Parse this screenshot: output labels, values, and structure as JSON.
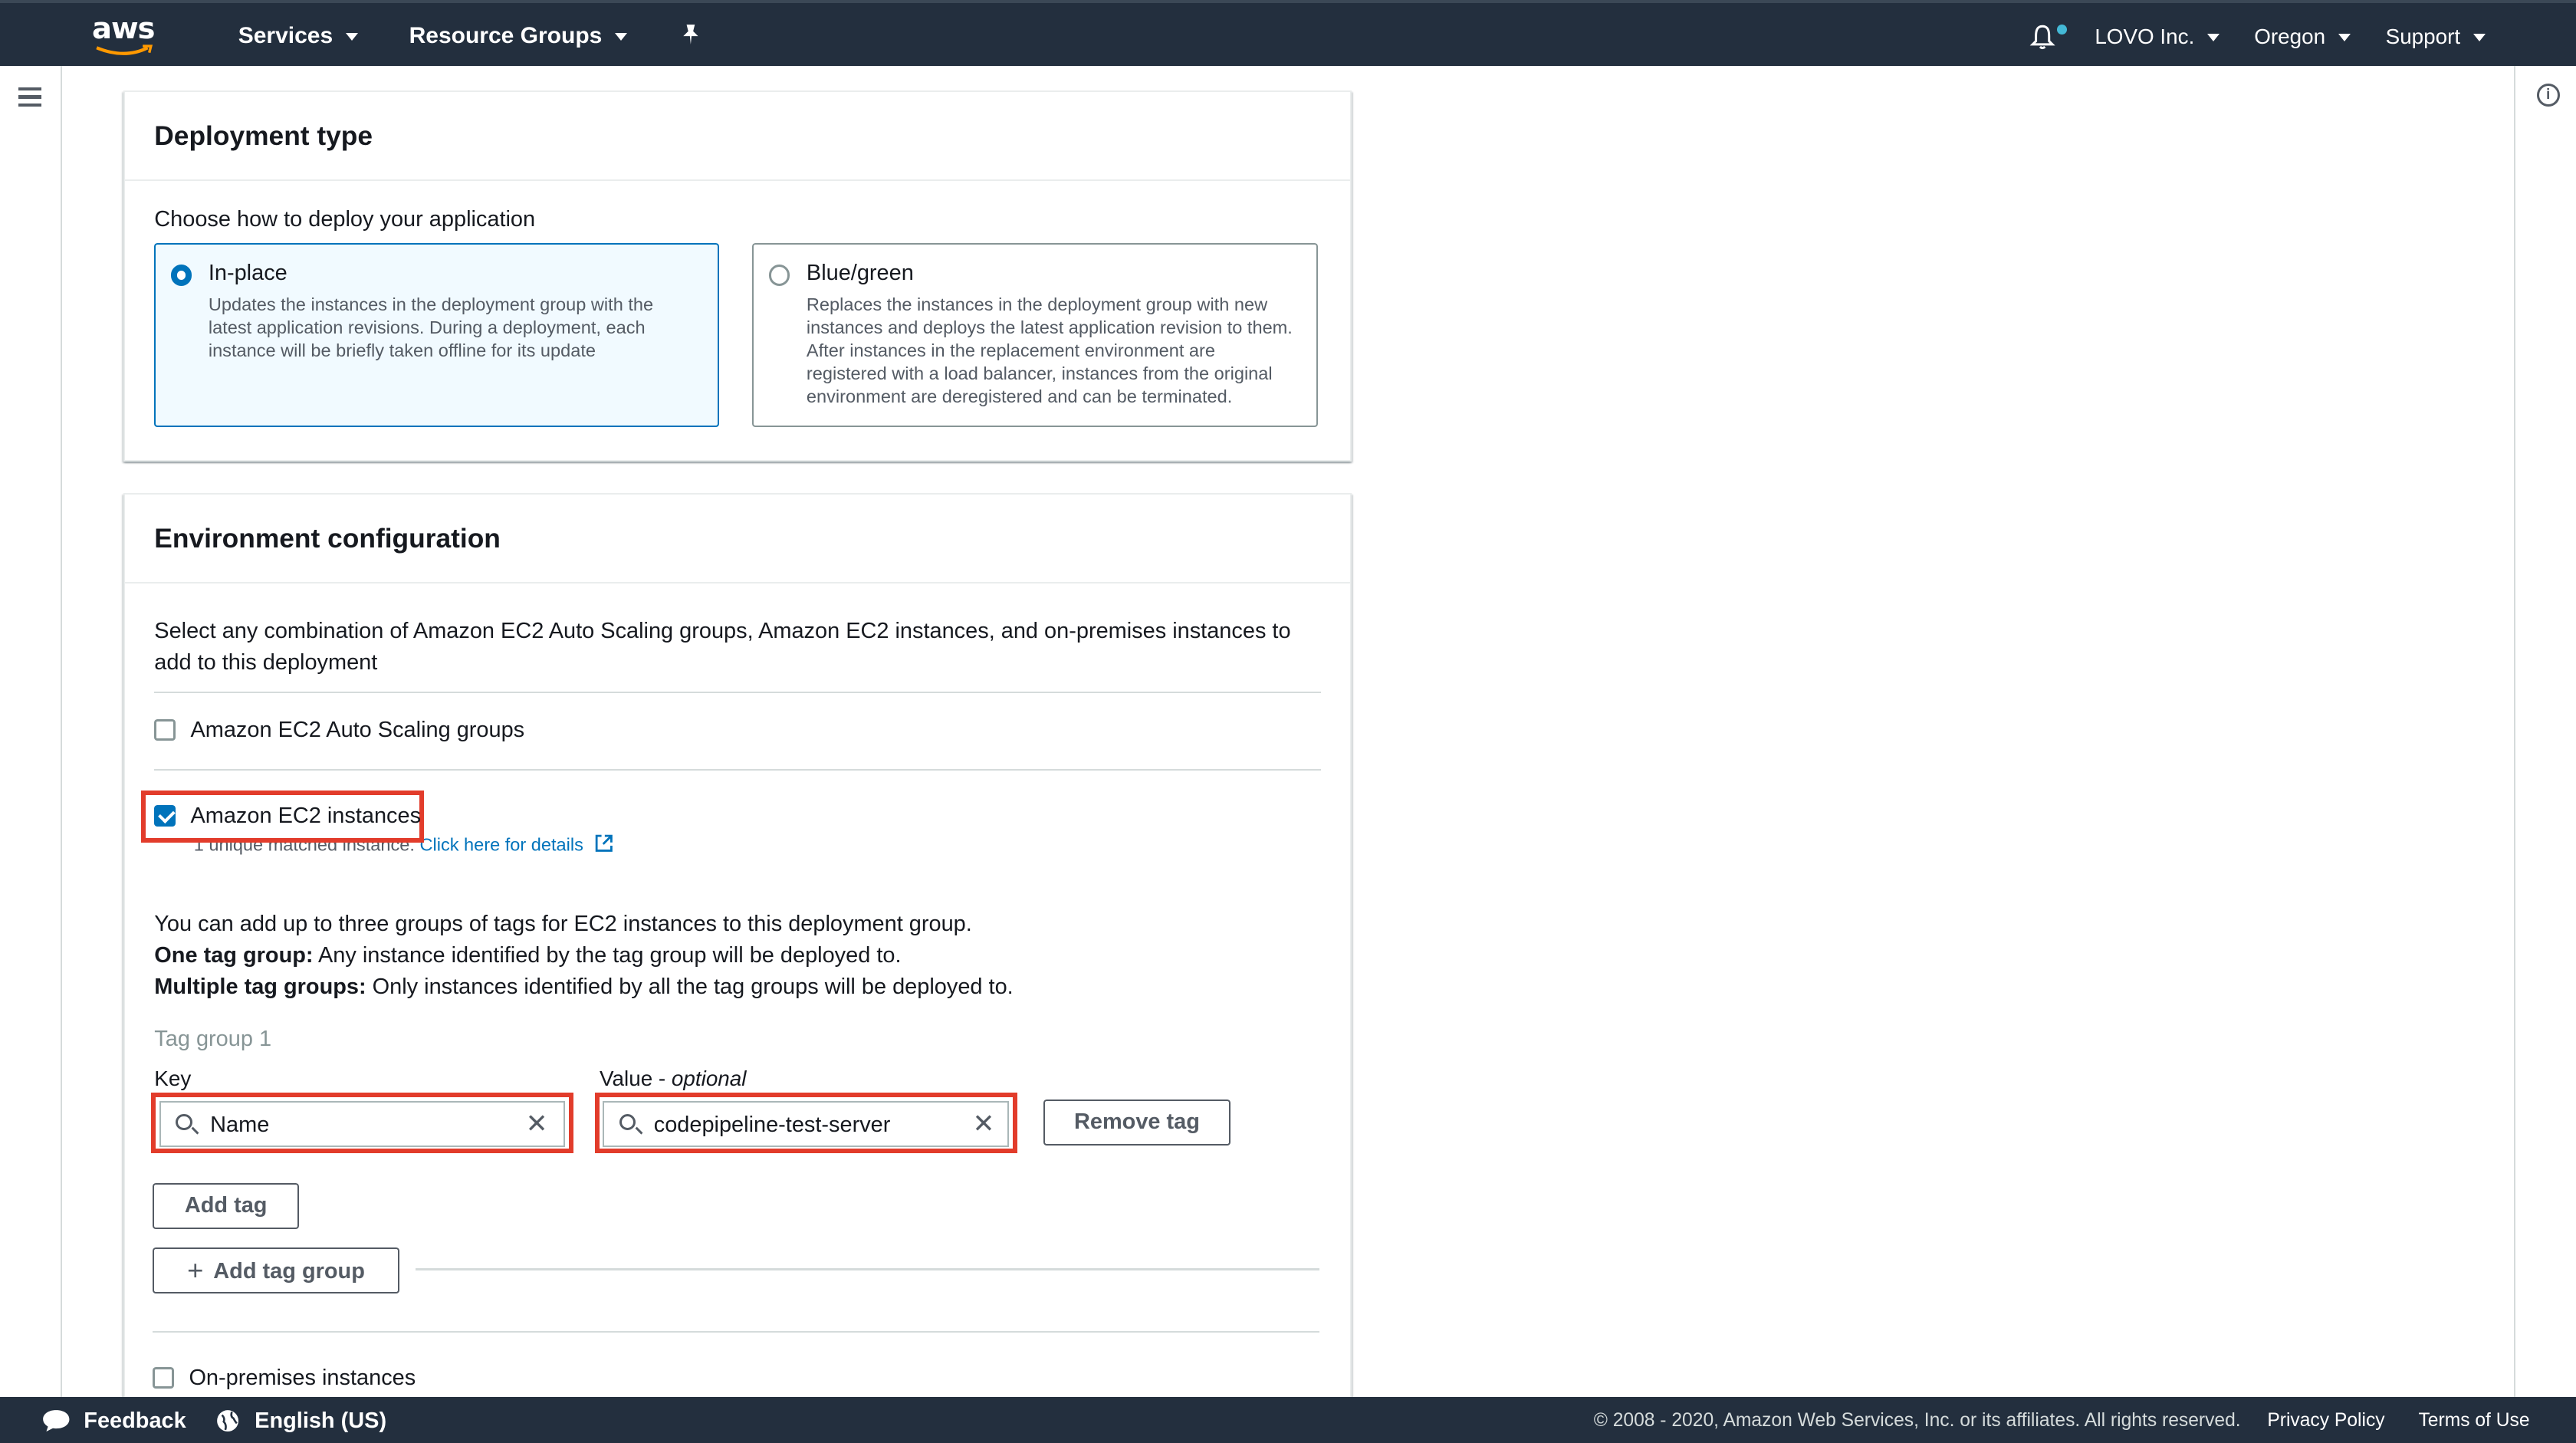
{
  "topnav": {
    "logo_text": "aws",
    "services": "Services",
    "resource_groups": "Resource Groups",
    "account": "LOVO Inc.",
    "region": "Oregon",
    "support": "Support"
  },
  "deployment_type": {
    "title": "Deployment type",
    "prompt": "Choose how to deploy your application",
    "options": [
      {
        "label": "In-place",
        "description": "Updates the instances in the deployment group with the latest application revisions. During a deployment, each instance will be briefly taken offline for its update",
        "selected": true
      },
      {
        "label": "Blue/green",
        "description": "Replaces the instances in the deployment group with new instances and deploys the latest application revision to them. After instances in the replacement environment are registered with a load balancer, instances from the original environment are deregistered and can be terminated.",
        "selected": false
      }
    ]
  },
  "environment": {
    "title": "Environment configuration",
    "intro": "Select any combination of Amazon EC2 Auto Scaling groups, Amazon EC2 instances, and on-premises instances to add to this deployment",
    "auto_scaling_label": "Amazon EC2 Auto Scaling groups",
    "auto_scaling_checked": false,
    "ec2_label": "Amazon EC2 instances",
    "ec2_checked": true,
    "matched_text": "1 unique matched instance.",
    "details_link": "Click here for details",
    "tags_info": "You can add up to three groups of tags for EC2 instances to this deployment group.",
    "one_group_bold": "One tag group:",
    "one_group_text": " Any instance identified by the tag group will be deployed to.",
    "multi_group_bold": "Multiple tag groups:",
    "multi_group_text": " Only instances identified by all the tag groups will be deployed to.",
    "tag_group_label": "Tag group 1",
    "key_label": "Key",
    "value_label": "Value - ",
    "value_optional": "optional",
    "key_value": "Name",
    "value_value": "codepipeline-test-server",
    "remove_tag": "Remove tag",
    "add_tag": "Add tag",
    "add_tag_group": "Add tag group",
    "on_prem_label": "On-premises instances",
    "on_prem_checked": false
  },
  "footer": {
    "feedback": "Feedback",
    "language": "English (US)",
    "copyright": "© 2008 - 2020, Amazon Web Services, Inc. or its affiliates. All rights reserved.",
    "privacy": "Privacy Policy",
    "terms": "Terms of Use"
  },
  "colors": {
    "nav_bg": "#232f3e",
    "accent": "#0073bb",
    "highlight": "#e23c2b"
  }
}
